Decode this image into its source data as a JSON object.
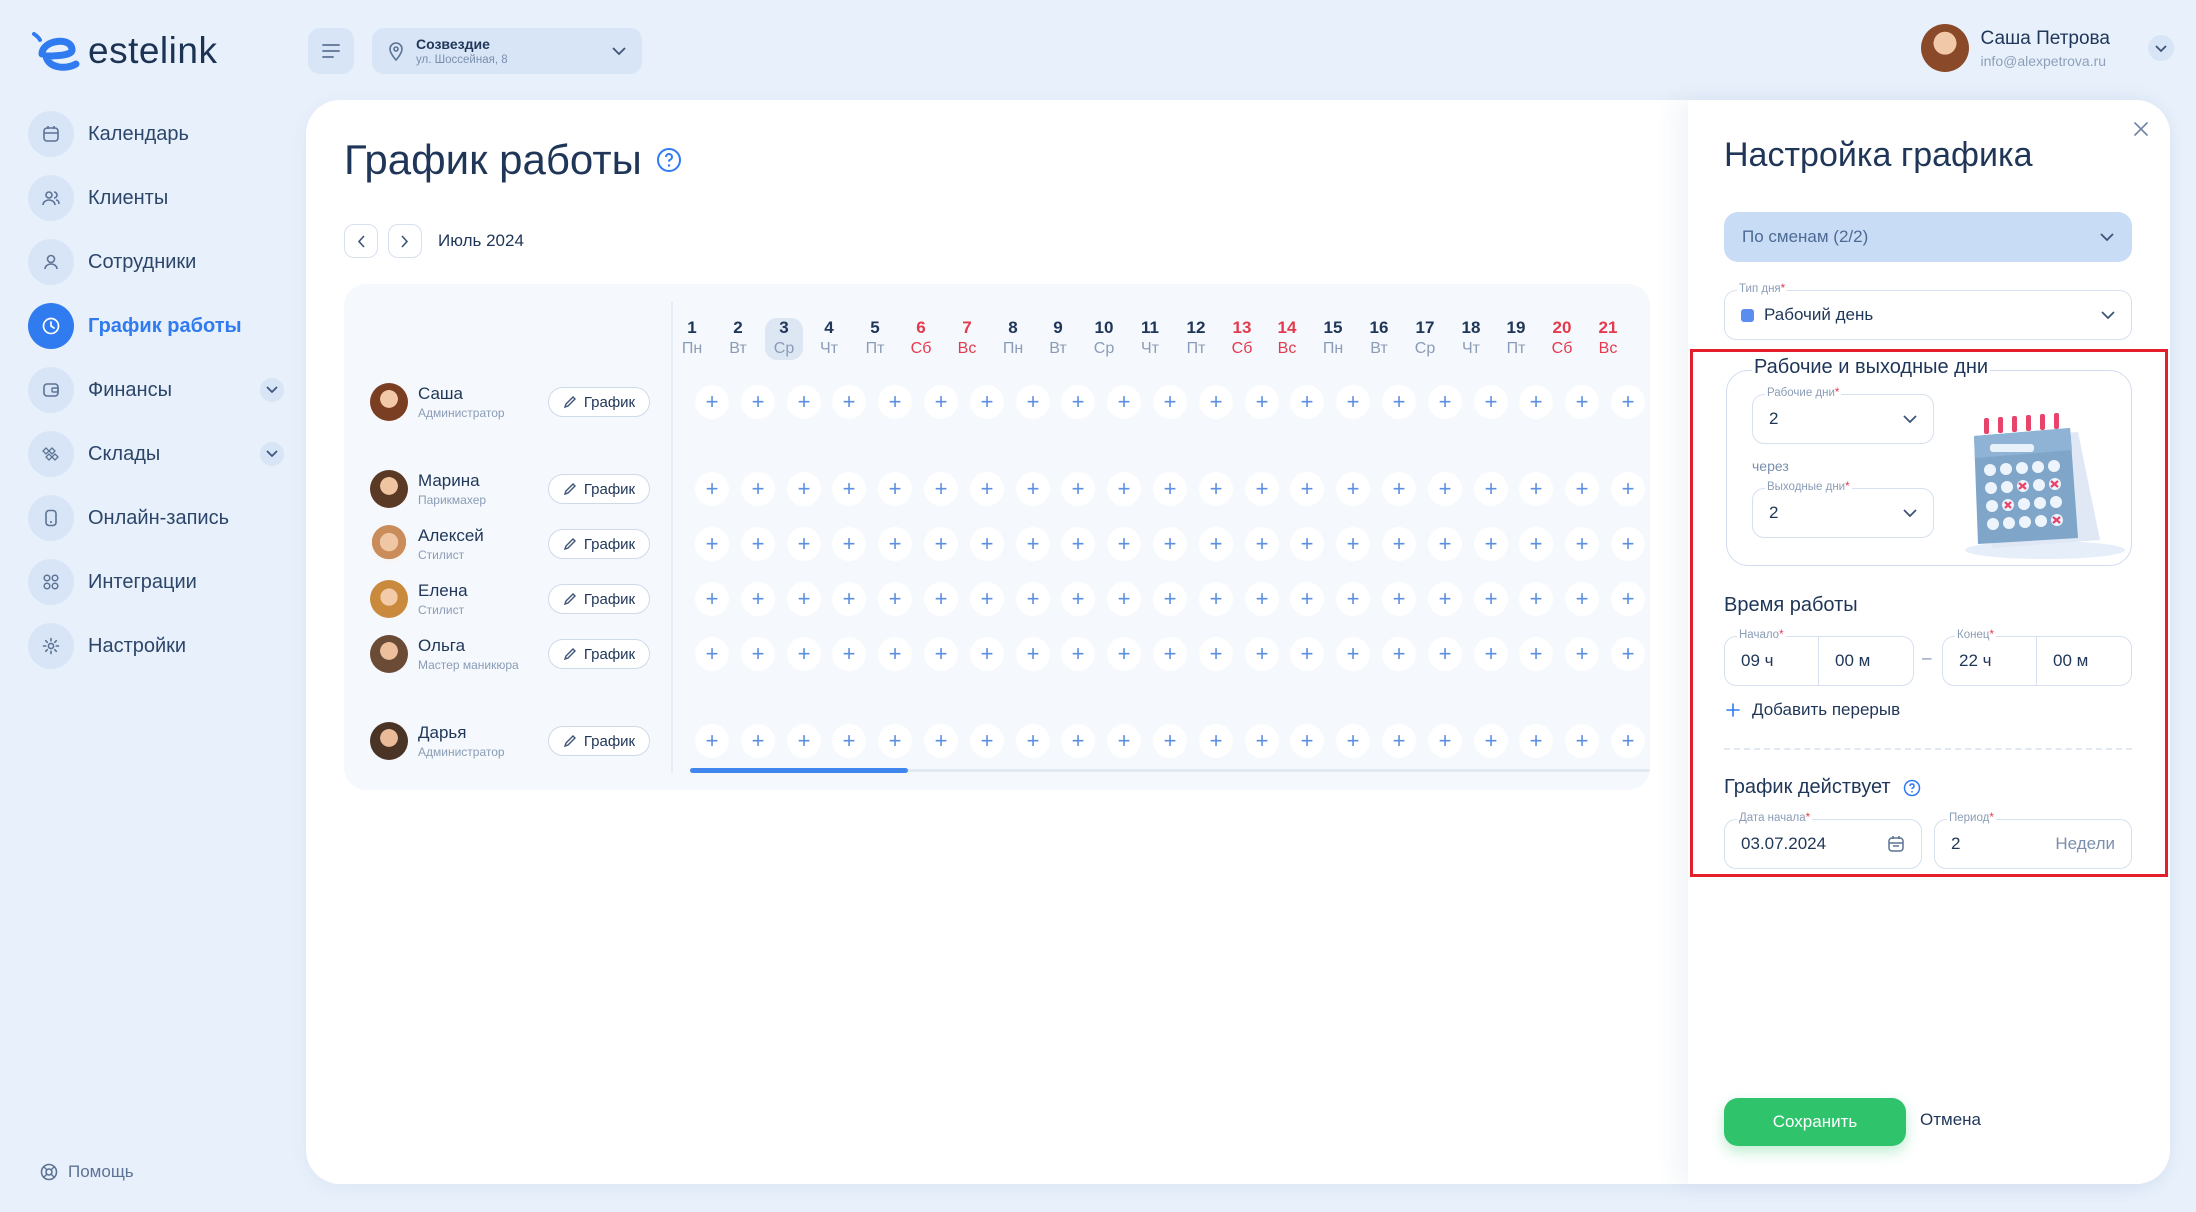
{
  "logo": {
    "text": "estelink",
    "brand_color": "#2f7bef"
  },
  "branch": {
    "name": "Созвездие",
    "address": "ул. Шоссейная, 8"
  },
  "user": {
    "name": "Саша Петрова",
    "email": "info@alexpetrova.ru"
  },
  "sidebar": {
    "items": [
      {
        "label": "Календарь",
        "icon": "calendar-icon"
      },
      {
        "label": "Клиенты",
        "icon": "clients-icon"
      },
      {
        "label": "Сотрудники",
        "icon": "employee-icon"
      },
      {
        "label": "График работы",
        "icon": "clock-icon",
        "active": true
      },
      {
        "label": "Финансы",
        "icon": "wallet-icon",
        "expandable": true
      },
      {
        "label": "Склады",
        "icon": "warehouse-icon",
        "expandable": true
      },
      {
        "label": "Онлайн-запись",
        "icon": "phone-icon"
      },
      {
        "label": "Интеграции",
        "icon": "integrations-icon"
      },
      {
        "label": "Настройки",
        "icon": "gear-icon"
      }
    ],
    "help": "Помощь"
  },
  "page": {
    "title": "График работы",
    "month": "Июль 2024"
  },
  "days": [
    {
      "n": "1",
      "w": "Пн"
    },
    {
      "n": "2",
      "w": "Вт"
    },
    {
      "n": "3",
      "w": "Ср",
      "today": true
    },
    {
      "n": "4",
      "w": "Чт"
    },
    {
      "n": "5",
      "w": "Пт"
    },
    {
      "n": "6",
      "w": "Сб",
      "weekend": true
    },
    {
      "n": "7",
      "w": "Вс",
      "weekend": true
    },
    {
      "n": "8",
      "w": "Пн"
    },
    {
      "n": "9",
      "w": "Вт"
    },
    {
      "n": "10",
      "w": "Ср"
    },
    {
      "n": "11",
      "w": "Чт"
    },
    {
      "n": "12",
      "w": "Пт"
    },
    {
      "n": "13",
      "w": "Сб",
      "weekend": true
    },
    {
      "n": "14",
      "w": "Вс",
      "weekend": true
    },
    {
      "n": "15",
      "w": "Пн"
    },
    {
      "n": "16",
      "w": "Вт"
    },
    {
      "n": "17",
      "w": "Ср"
    },
    {
      "n": "18",
      "w": "Чт"
    },
    {
      "n": "19",
      "w": "Пт"
    },
    {
      "n": "20",
      "w": "Сб",
      "weekend": true
    },
    {
      "n": "21",
      "w": "Вс",
      "weekend": true
    }
  ],
  "employees": [
    {
      "name": "Саша",
      "role": "Администратор"
    },
    {
      "name": "Марина",
      "role": "Парикмахер"
    },
    {
      "name": "Алексей",
      "role": "Стилист"
    },
    {
      "name": "Елена",
      "role": "Стилист"
    },
    {
      "name": "Ольга",
      "role": "Мастер маникюра"
    },
    {
      "name": "Дарья",
      "role": "Администратор"
    }
  ],
  "schedule_button_label": "График",
  "settings": {
    "title": "Настройка графика",
    "mode": "По сменам (2/2)",
    "day_type": {
      "label": "Тип дня",
      "value": "Рабочий день",
      "color": "#5b8def"
    },
    "work_off": {
      "title": "Рабочие и выходные дни",
      "work_label": "Рабочие дни",
      "work_value": "2",
      "through": "через",
      "off_label": "Выходные дни",
      "off_value": "2"
    },
    "work_time": {
      "title": "Время работы",
      "start_label": "Начало",
      "start_h": "09 ч",
      "start_m": "00 м",
      "dash": "–",
      "end_label": "Конец",
      "end_h": "22 ч",
      "end_m": "00 м",
      "add_break": "Добавить перерыв"
    },
    "validity": {
      "title": "График действует",
      "date_label": "Дата начала",
      "date_value": "03.07.2024",
      "period_label": "Период",
      "period_value": "2",
      "period_unit": "Недели"
    },
    "save": "Сохранить",
    "cancel": "Отмена"
  }
}
